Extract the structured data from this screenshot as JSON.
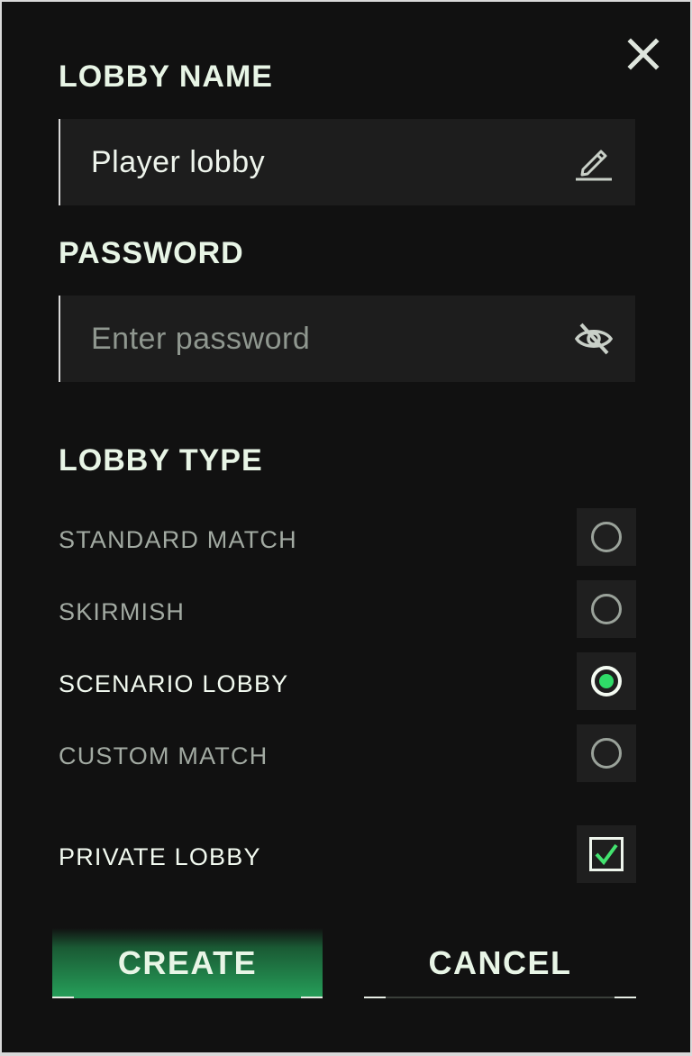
{
  "lobby_name": {
    "title": "LOBBY NAME",
    "value": "Player lobby",
    "icon": "pencil-icon"
  },
  "password": {
    "title": "PASSWORD",
    "placeholder": "Enter password",
    "icon": "eye-off-icon"
  },
  "lobby_type": {
    "title": "LOBBY TYPE",
    "options": [
      {
        "label": "STANDARD MATCH",
        "selected": false
      },
      {
        "label": "SKIRMISH",
        "selected": false
      },
      {
        "label": "SCENARIO LOBBY",
        "selected": true
      },
      {
        "label": "CUSTOM MATCH",
        "selected": false
      }
    ]
  },
  "private_lobby": {
    "label": "PRIVATE LOBBY",
    "checked": true
  },
  "buttons": {
    "create": "CREATE",
    "cancel": "CANCEL"
  },
  "colors": {
    "background": "#111111",
    "field": "#1d1d1d",
    "accent_green": "#2fdc68",
    "text": "#e8f5e6"
  }
}
